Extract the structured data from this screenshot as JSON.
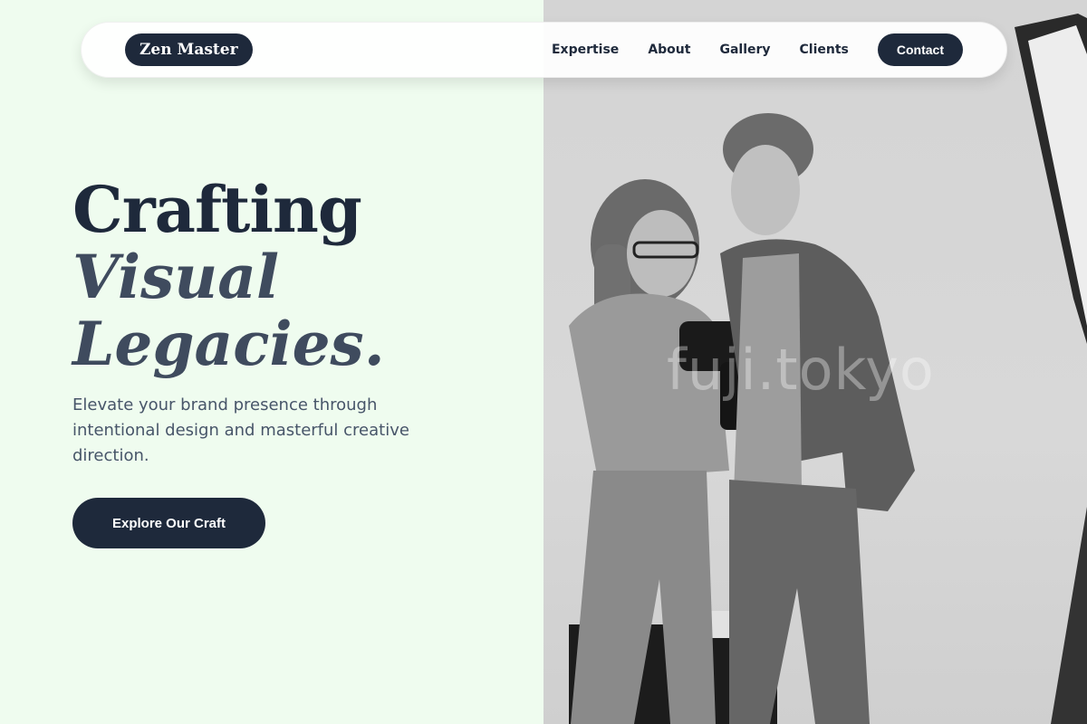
{
  "brand": {
    "logo_text": "Zen Master"
  },
  "nav": {
    "links": [
      "Expertise",
      "About",
      "Gallery",
      "Clients"
    ],
    "contact_label": "Contact"
  },
  "hero": {
    "title_line1": "Crafting",
    "title_line2": "Visual",
    "title_line3": "Legacies.",
    "subtitle": "Elevate your brand presence through intentional design and masterful creative direction.",
    "cta_label": "Explore Our Craft"
  },
  "photo": {
    "watermark": "fuji.tokyo"
  },
  "colors": {
    "accent": "#1e293b",
    "background": "#effcef",
    "subtext": "#475569"
  }
}
